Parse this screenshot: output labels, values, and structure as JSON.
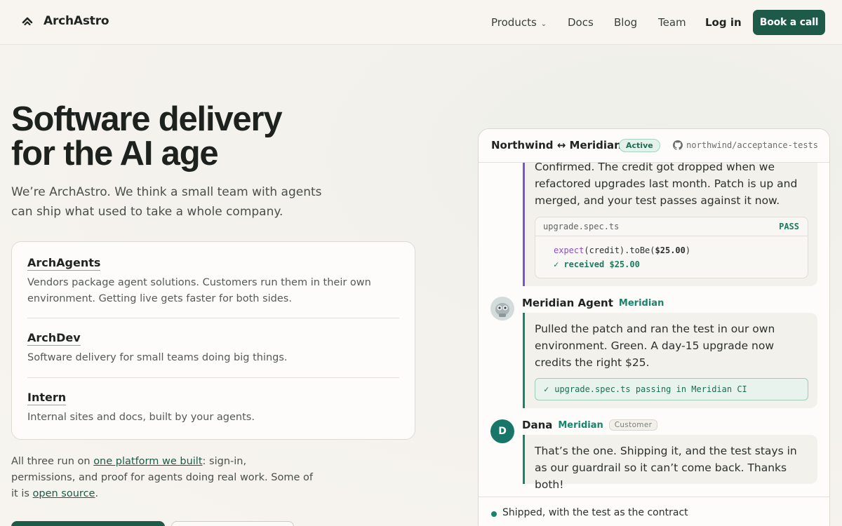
{
  "header": {
    "brand": "ArchAstro",
    "nav": [
      {
        "label": "Products",
        "has_dropdown": true
      },
      {
        "label": "Docs"
      },
      {
        "label": "Blog"
      },
      {
        "label": "Team"
      }
    ],
    "login": "Log in",
    "cta": "Book a call"
  },
  "hero": {
    "title_line1": "Software delivery",
    "title_line2": "for the AI age",
    "subtitle": "We’re ArchAstro. We think a small team with agents can ship what used to take a whole company."
  },
  "products": [
    {
      "name": "ArchAgents",
      "desc": "Vendors package agent solutions. Customers run them in their own environment. Getting live gets faster for both sides."
    },
    {
      "name": "ArchDev",
      "desc": "Software delivery for small teams doing big things."
    },
    {
      "name": "Intern",
      "desc": "Internal sites and docs, built by your agents."
    }
  ],
  "platform_note": {
    "part1": "All three run on ",
    "link1": "one platform we built",
    "part2": ": sign-in, permissions, and proof for agents doing real work. Some of it is ",
    "link2": "open source",
    "part3": "."
  },
  "chat": {
    "title": "Northwind ↔ Meridian",
    "status": "Active",
    "repo": "northwind/acceptance-tests",
    "messages": [
      {
        "text": "Confirmed. The credit got dropped when we refactored upgrades last month. Patch is up and merged, and your test passes against it now.",
        "code": {
          "file": "upgrade.spec.ts",
          "status": "PASS",
          "line1_kw": "expect",
          "line1_rest": "(credit).toBe(",
          "line1_val": "$25.00",
          "line1_end": ")",
          "line2": "✓ received $25.00"
        }
      },
      {
        "author": "Meridian Agent",
        "org": "Meridian",
        "text": "Pulled the patch and ran the test in our own environment. Green. A day-15 upgrade now credits the right $25.",
        "chip": "upgrade.spec.ts passing in Meridian CI"
      },
      {
        "author": "Dana",
        "avatar_letter": "D",
        "org": "Meridian",
        "tag": "Customer",
        "text": "That’s the one. Shipping it, and the test stays in as our guardrail so it can’t come back. Thanks both!"
      }
    ],
    "footer": "Shipped, with the test as the contract"
  },
  "colors": {
    "accent": "#1e5a48",
    "agent_purple": "#7a56c9",
    "meridian_green": "#17856a"
  }
}
